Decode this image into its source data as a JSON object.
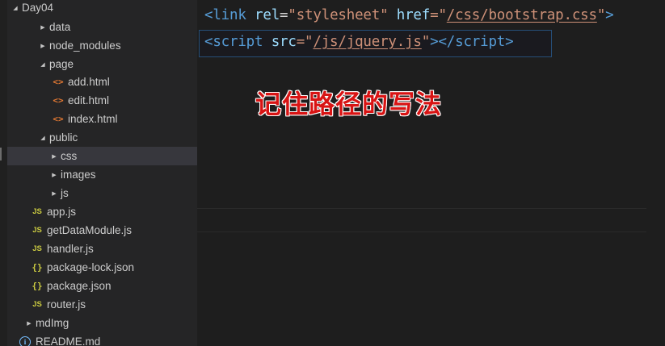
{
  "explorer": {
    "items": [
      {
        "label": "Day04",
        "icon": "",
        "twisty": "expanded"
      },
      {
        "label": "data",
        "icon": "",
        "twisty": "collapsed"
      },
      {
        "label": "node_modules",
        "icon": "",
        "twisty": "collapsed"
      },
      {
        "label": "page",
        "icon": "",
        "twisty": "expanded"
      },
      {
        "label": "add.html",
        "icon": "<>",
        "twisty": ""
      },
      {
        "label": "edit.html",
        "icon": "<>",
        "twisty": ""
      },
      {
        "label": "index.html",
        "icon": "<>",
        "twisty": ""
      },
      {
        "label": "public",
        "icon": "",
        "twisty": "expanded"
      },
      {
        "label": "css",
        "icon": "",
        "twisty": "collapsed"
      },
      {
        "label": "images",
        "icon": "",
        "twisty": "collapsed"
      },
      {
        "label": "js",
        "icon": "",
        "twisty": "collapsed"
      },
      {
        "label": "app.js",
        "icon": "JS",
        "twisty": ""
      },
      {
        "label": "getDataModule.js",
        "icon": "JS",
        "twisty": ""
      },
      {
        "label": "handler.js",
        "icon": "JS",
        "twisty": ""
      },
      {
        "label": "package-lock.json",
        "icon": "{}",
        "twisty": ""
      },
      {
        "label": "package.json",
        "icon": "{}",
        "twisty": ""
      },
      {
        "label": "router.js",
        "icon": "JS",
        "twisty": ""
      },
      {
        "label": "mdImg",
        "icon": "",
        "twisty": "collapsed"
      },
      {
        "label": "README.md",
        "icon": "ⓘ",
        "twisty": ""
      }
    ]
  },
  "editor": {
    "line1": {
      "open": "<",
      "tag": "link",
      "attr1": "rel",
      "eq1": "=",
      "val1": "\"stylesheet\"",
      "attr2": "href",
      "eq2": "=\"",
      "val2": "/css/bootstrap.css",
      "q2": "\"",
      "close": ">"
    },
    "line2": {
      "open": "<",
      "tag": "script",
      "attr1": "src",
      "eq1": "=\"",
      "val1": "/js/jquery.js",
      "q1": "\"",
      "mid": "></",
      "tag2": "script",
      "close": ">"
    },
    "annotation": "记住路径的写法"
  },
  "colors": {
    "sidebar_bg": "#252526",
    "editor_bg": "#1e1e1e",
    "tag": "#569cd6",
    "attribute": "#9cdcfe",
    "string": "#ce9178",
    "annotation": "#d81414"
  }
}
